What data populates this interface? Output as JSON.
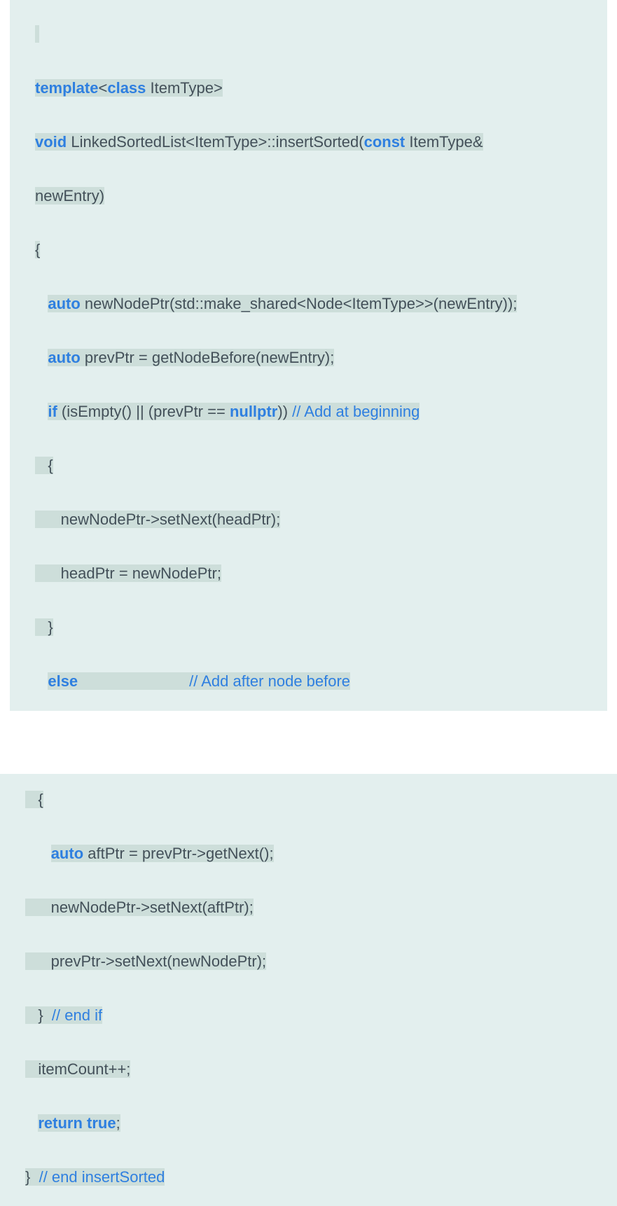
{
  "code": {
    "block1": {
      "l1a": "template",
      "l1b": "<",
      "l1c": "class",
      "l1d": " ItemType>",
      "l2a": "void",
      "l2b": " LinkedSortedList<ItemType>::insertSorted(",
      "l2c": "const",
      "l2d": " ItemType&",
      "l3": "newEntry)",
      "l4": "{",
      "l5a": "   ",
      "l5b": "auto",
      "l5c": " newNodePtr(std::make_shared<Node<ItemType>>(newEntry));",
      "l6a": "   ",
      "l6b": "auto",
      "l6c": " prevPtr = getNodeBefore(newEntry);",
      "l7a": "   ",
      "l7b": "if",
      "l7c": " (isEmpty() || (prevPtr == ",
      "l7d": "nullptr",
      "l7e": ")) ",
      "l7f": "// Add at beginning",
      "l8": "   {",
      "l9": "      newNodePtr->setNext(headPtr);",
      "l10": "      headPtr = newNodePtr;",
      "l11": "   }",
      "l12a": "   ",
      "l12b": "else",
      "l12c": "                          ",
      "l12d": "// Add after node before"
    },
    "block2": {
      "l1": "   {",
      "l2a": "      ",
      "l2b": "auto",
      "l2c": " aftPtr = prevPtr->getNext();",
      "l3": "      newNodePtr->setNext(aftPtr);",
      "l4": "      prevPtr->setNext(newNodePtr);",
      "l5a": "   }  ",
      "l5b": "// end if",
      "l6": "   itemCount++;",
      "l7a": "   ",
      "l7b": "return",
      "l7c": " ",
      "l7d": "true",
      "l7e": ";",
      "l8a": "}  ",
      "l8b": "// end insertSorted"
    }
  }
}
